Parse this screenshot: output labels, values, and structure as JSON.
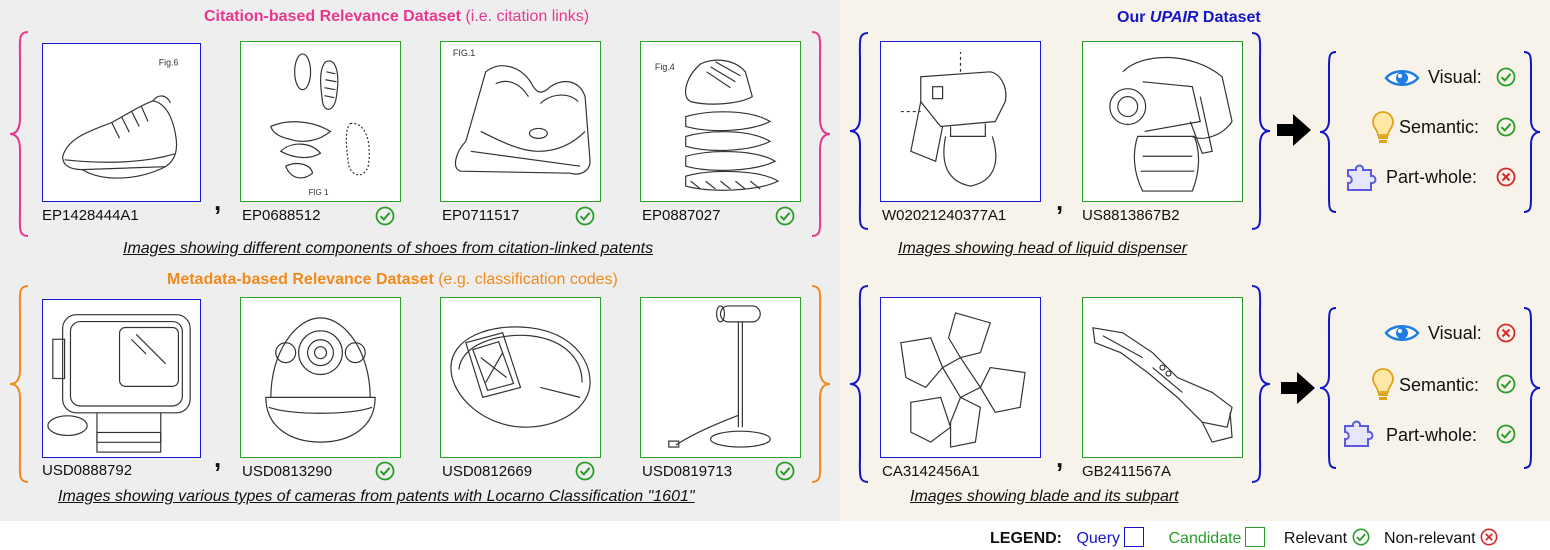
{
  "colors": {
    "pink": "#e6388f",
    "orange": "#f08a1c",
    "blue": "#1515c8",
    "green": "#2a9d2a",
    "red": "#d62a2a",
    "gray_bg": "#eeeeee",
    "beige_bg": "#f7f3ea"
  },
  "citation": {
    "title_bold": "Citation-based Relevance Dataset",
    "title_rest": " (i.e. citation links)",
    "ids": [
      "EP1428444A1",
      "EP0688512",
      "EP0711517",
      "EP0887027"
    ],
    "caption": "Images showing different components of shoes from citation-linked patents"
  },
  "metadata": {
    "title_bold": "Metadata-based Relevance Dataset",
    "title_rest": " (e.g. classification codes)",
    "ids": [
      "USD0888792",
      "USD0813290",
      "USD0812669",
      "USD0819713"
    ],
    "caption": "Images showing various types of cameras from patents with Locarno Classification \"1601\""
  },
  "upair": {
    "title_pre": "Our ",
    "title_em": "UPAIR",
    "title_post": " Dataset",
    "top_ids": [
      "W02021240377A1",
      "US8813867B2"
    ],
    "top_caption": "Images showing head of liquid dispenser",
    "bottom_ids": [
      "CA3142456A1",
      "GB2411567A"
    ],
    "bottom_caption": "Images showing blade and its subpart",
    "top_attrs": [
      {
        "label": "Visual:",
        "icon": "eye-icon",
        "status": "relevant"
      },
      {
        "label": "Semantic:",
        "icon": "lightbulb-icon",
        "status": "relevant"
      },
      {
        "label": "Part-whole:",
        "icon": "puzzle-icon",
        "status": "non-relevant"
      }
    ],
    "bottom_attrs": [
      {
        "label": "Visual:",
        "icon": "eye-icon",
        "status": "non-relevant"
      },
      {
        "label": "Semantic:",
        "icon": "lightbulb-icon",
        "status": "relevant"
      },
      {
        "label": "Part-whole:",
        "icon": "puzzle-icon",
        "status": "relevant"
      }
    ]
  },
  "comma": ",",
  "legend": {
    "title": "LEGEND:",
    "query": "Query",
    "candidate": "Candidate",
    "relevant": "Relevant",
    "nonrelevant": "Non-relevant"
  }
}
